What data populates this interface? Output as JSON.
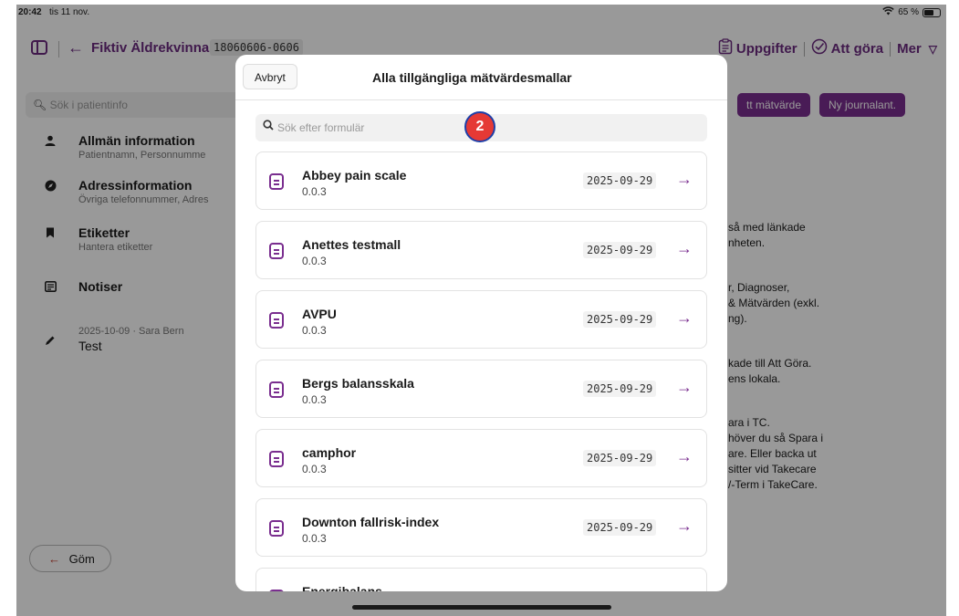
{
  "status_bar": {
    "time": "20:42",
    "date": "tis 11 nov.",
    "wifi_icon": "wifi-icon",
    "battery": "65 %"
  },
  "topbar": {
    "back_label": "Fiktiv Äldrekvinna",
    "personnummer": "18060606-0606",
    "tasks_label": "Uppgifter",
    "todo_label": "Att göra",
    "more_label": "Mer"
  },
  "background": {
    "search_placeholder": "Sök i patientinfo",
    "sidebar": [
      {
        "title": "Allmän information",
        "subtitle": "Patientnamn, Personnumme",
        "icon": "person-icon"
      },
      {
        "title": "Adressinformation",
        "subtitle": "Övriga telefonnummer, Adres",
        "icon": "compass-icon"
      },
      {
        "title": "Etiketter",
        "subtitle": "Hantera etiketter",
        "icon": "bookmark-icon"
      },
      {
        "title": "Notiser",
        "subtitle": "",
        "icon": "note-icon"
      }
    ],
    "note_meta": "2025-10-09 · Sara Bern",
    "note_title": "Test",
    "add_measurement_btn": "tt mätvärde",
    "new_journal_btn": "Ny journalant.",
    "right_texts": [
      "så med länkade",
      "nheten.",
      "r, Diagnoser,",
      "& Mätvärden (exkl.",
      "ng).",
      "kade till Att Göra.",
      "ens lokala.",
      "ara i TC.",
      "höver du så Spara i",
      "are. Eller backa ut",
      "sitter vid Takecare",
      "/-Term i TakeCare."
    ],
    "hide_label": "Göm"
  },
  "modal": {
    "cancel_label": "Avbryt",
    "title": "Alla tillgängliga mätvärdesmallar",
    "search_placeholder": "Sök efter formulär",
    "items": [
      {
        "name": "Abbey pain scale",
        "version": "0.0.3",
        "date": "2025-09-29"
      },
      {
        "name": "Anettes testmall",
        "version": "0.0.3",
        "date": "2025-09-29"
      },
      {
        "name": "AVPU",
        "version": "0.0.3",
        "date": "2025-09-29"
      },
      {
        "name": "Bergs balansskala",
        "version": "0.0.3",
        "date": "2025-09-29"
      },
      {
        "name": "camphor",
        "version": "0.0.3",
        "date": "2025-09-29"
      },
      {
        "name": "Downton fallrisk-index",
        "version": "0.0.3",
        "date": "2025-09-29"
      },
      {
        "name": "Energibalans",
        "version": "",
        "date": ""
      }
    ]
  },
  "marker_label": "2",
  "colors": {
    "accent": "#7a2e8f",
    "marker": "#e53935"
  }
}
